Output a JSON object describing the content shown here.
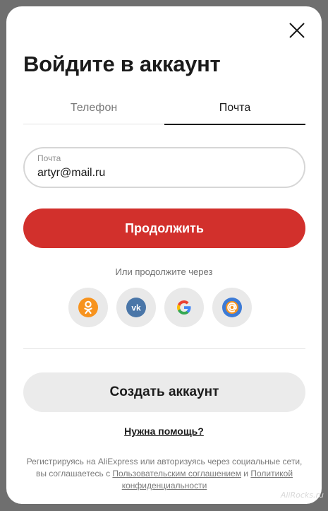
{
  "modal": {
    "title": "Войдите в аккаунт",
    "close_icon": "close-icon"
  },
  "tabs": [
    {
      "label": "Телефон",
      "active": false
    },
    {
      "label": "Почта",
      "active": true
    }
  ],
  "email_field": {
    "label": "Почта",
    "value": "artyr@mail.ru"
  },
  "continue_button": "Продолжить",
  "social": {
    "heading": "Или продолжите через",
    "providers": [
      {
        "icon": "odnoklassniki-icon",
        "color": "#f7931e"
      },
      {
        "icon": "vk-icon",
        "color": "#4a76a8"
      },
      {
        "icon": "google-icon",
        "color": "#4285f4"
      },
      {
        "icon": "mailru-icon",
        "color": "#3d7bd6"
      }
    ]
  },
  "create_account_button": "Создать аккаунт",
  "help_link": "Нужна помощь?",
  "legal": {
    "text_1": "Регистрируясь на AliExpress или авторизуясь через социальные сети, вы соглашаетесь с ",
    "link_terms": "Пользовательским соглашением",
    "text_2": " и ",
    "link_privacy": "Политикой конфиденциальности"
  },
  "watermark": "AliRocks.ru",
  "colors": {
    "accent": "#d2302c",
    "text": "#1b1b1b",
    "muted": "#7a7a7a"
  }
}
